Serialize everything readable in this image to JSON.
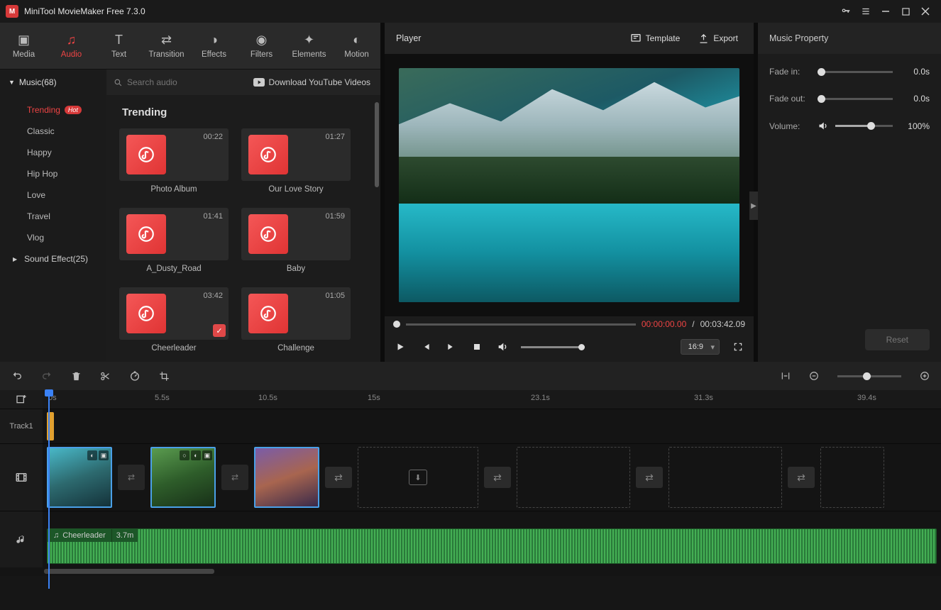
{
  "app": {
    "title": "MiniTool MovieMaker Free 7.3.0"
  },
  "tabs": [
    {
      "id": "media",
      "label": "Media"
    },
    {
      "id": "audio",
      "label": "Audio"
    },
    {
      "id": "text",
      "label": "Text"
    },
    {
      "id": "transition",
      "label": "Transition"
    },
    {
      "id": "effects",
      "label": "Effects"
    },
    {
      "id": "filters",
      "label": "Filters"
    },
    {
      "id": "elements",
      "label": "Elements"
    },
    {
      "id": "motion",
      "label": "Motion"
    }
  ],
  "browser": {
    "root_label": "Music(68)",
    "search_placeholder": "Search audio",
    "youtube_link": "Download YouTube Videos",
    "categories": [
      {
        "label": "Trending",
        "hot": true,
        "selected": true
      },
      {
        "label": "Classic"
      },
      {
        "label": "Happy"
      },
      {
        "label": "Hip Hop"
      },
      {
        "label": "Love"
      },
      {
        "label": "Travel"
      },
      {
        "label": "Vlog"
      }
    ],
    "sound_effect_label": "Sound Effect(25)",
    "grid_title": "Trending",
    "clips": [
      {
        "name": "Photo Album",
        "duration": "00:22"
      },
      {
        "name": "Our Love Story",
        "duration": "01:27"
      },
      {
        "name": "A_Dusty_Road",
        "duration": "01:41"
      },
      {
        "name": "Baby",
        "duration": "01:59"
      },
      {
        "name": "Cheerleader",
        "duration": "03:42",
        "checked": true
      },
      {
        "name": "Challenge",
        "duration": "01:05"
      }
    ]
  },
  "player": {
    "title": "Player",
    "template_label": "Template",
    "export_label": "Export",
    "current_tc": "00:00:00.00",
    "sep": "/",
    "total_tc": "00:03:42.09",
    "aspect": "16:9"
  },
  "props": {
    "title": "Music Property",
    "fade_in_label": "Fade in:",
    "fade_in_value": "0.0s",
    "fade_out_label": "Fade out:",
    "fade_out_value": "0.0s",
    "volume_label": "Volume:",
    "volume_value": "100%",
    "reset": "Reset"
  },
  "timeline": {
    "ticks": [
      "0s",
      "5.5s",
      "10.5s",
      "15s",
      "23.1s",
      "31.3s",
      "39.4s"
    ],
    "tick_pos": [
      8,
      158,
      304,
      458,
      688,
      918,
      1148
    ],
    "track1_label": "Track1",
    "audio_clip_name": "Cheerleader",
    "audio_clip_len": "3.7m"
  }
}
